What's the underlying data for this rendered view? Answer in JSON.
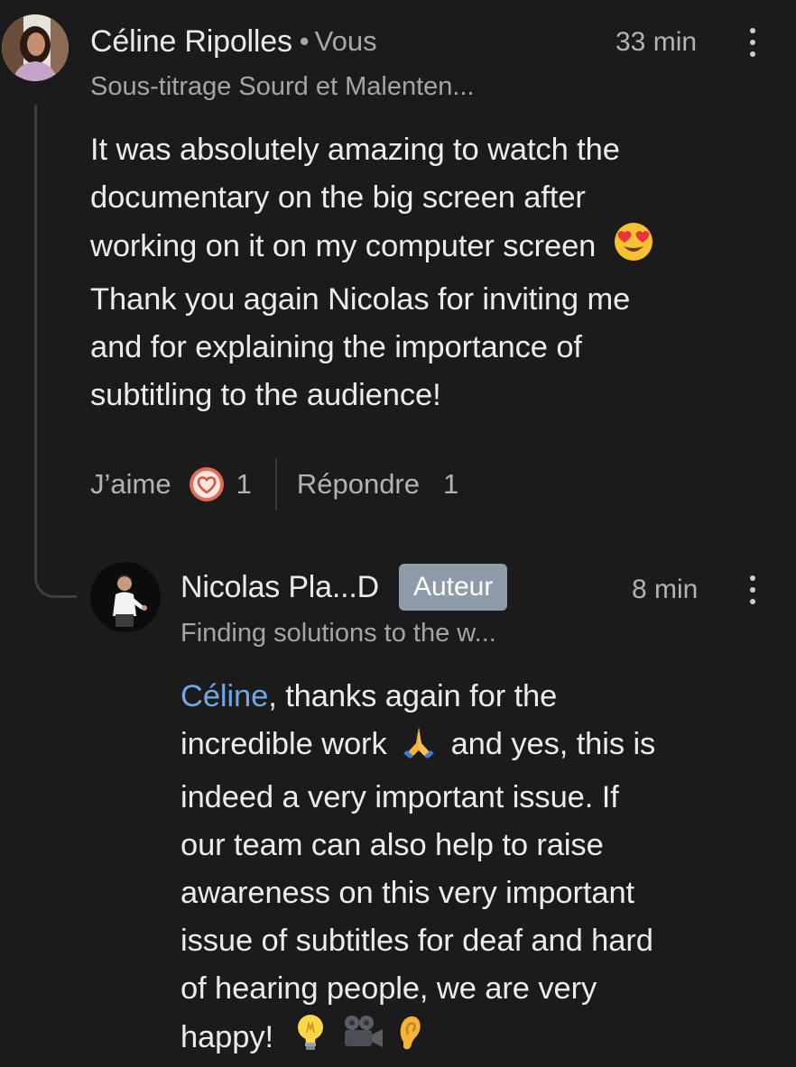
{
  "comment": {
    "author": "Céline Ripolles",
    "separator": "•",
    "you_label": "Vous",
    "headline": "Sous-titrage Sourd et Malenten...",
    "time": "33 min",
    "text_lines": [
      "It was absolutely amazing to watch the",
      "documentary on the big screen after",
      "working on it on my computer screen",
      "Thank you again Nicolas for inviting me",
      "and for explaining the importance of",
      "subtitling to the audience!"
    ],
    "emoji_line_3": "heart-eyes-emoji",
    "actions": {
      "like_label": "J’aime",
      "reaction_count": "1",
      "reply_label": "Répondre",
      "reply_count": "1"
    }
  },
  "reply": {
    "author": "Nicolas Pla...D",
    "badge": "Auteur",
    "headline": "Finding solutions to the w...",
    "time": "8 min",
    "mention": "Céline",
    "line1_rest": ", thanks again for the",
    "line2_a": "incredible work",
    "line2_b": " and yes, this is",
    "lines_rest": [
      "indeed a very important issue. If",
      "our team can also help to raise",
      "awareness on this very important",
      "issue of subtitles for deaf and hard",
      "of hearing people, we are very"
    ],
    "last_line": "happy!",
    "emojis": [
      "praying-hands-emoji",
      "light-bulb-emoji",
      "movie-camera-emoji",
      "ear-emoji"
    ]
  },
  "colors": {
    "background": "#1b1b1b",
    "mention": "#71a6e8",
    "badge": "#8e9ba9",
    "reaction_heart": "#e06c5a"
  }
}
